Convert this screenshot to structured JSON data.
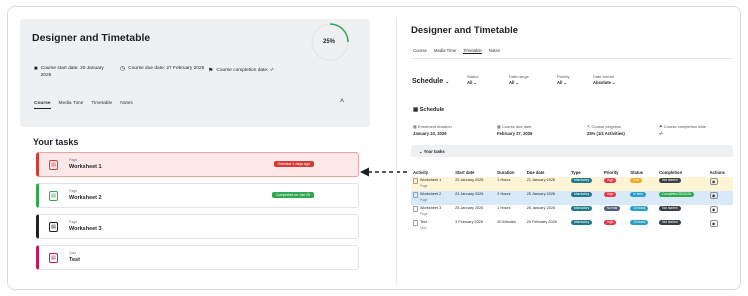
{
  "left": {
    "title": "Designer and Timetable",
    "progress_text": "25%",
    "progress_value": 0.25,
    "start": "Course start date: 20 January 2026",
    "due": "Course due date: 27 February 2026",
    "completion": "Course completion date: -/-",
    "tabs": [
      "Course",
      "Media Time",
      "Timetable",
      "Notes"
    ],
    "your_tasks": "Your tasks",
    "tasks": [
      {
        "type": "Page",
        "name": "Worksheet 1",
        "badge": "Overdue 1 days ago",
        "badge_color": "#d63b3b",
        "accent": "#d63b3b"
      },
      {
        "type": "Page",
        "name": "Worksheet 2",
        "badge": "Completed on Jan 25",
        "badge_color": "#2fa84f",
        "accent": "#2fa84f"
      },
      {
        "type": "Page",
        "name": "Worksheet 3",
        "badge": "",
        "badge_color": "",
        "accent": "#1d2125"
      },
      {
        "type": "Quiz",
        "name": "Test",
        "badge": "",
        "badge_color": "",
        "accent": "#c2185b"
      }
    ]
  },
  "right": {
    "title": "Designer and Timetable",
    "tabs": [
      "Course",
      "Media Time",
      "Timetable",
      "Notes"
    ],
    "schedule_select": "Schedule",
    "filters": [
      {
        "label": "Status",
        "value": "All"
      },
      {
        "label": "Date range",
        "value": "All"
      },
      {
        "label": "Priority",
        "value": "All"
      },
      {
        "label": "Date format",
        "value": "Absolute"
      }
    ],
    "section": "Schedule",
    "info": [
      {
        "label": "Enrolment duration",
        "value": "January 23, 2026"
      },
      {
        "label": "Course due date",
        "value": "February 27, 2026"
      },
      {
        "label": "Course progress",
        "value": "25% (1/4 Activities)"
      },
      {
        "label": "Course completion date",
        "value": "-/-"
      }
    ],
    "tasks_bar": "Your tasks",
    "columns": [
      "Activity",
      "Start date",
      "Duration",
      "Due date",
      "Type",
      "Priority",
      "Status",
      "Completion",
      "Actions"
    ],
    "rows": [
      {
        "name": "Worksheet 1",
        "sub": "Page",
        "start": "20 January 2026",
        "duration": "1 Hours",
        "due": "21 January 2026",
        "type": "Mandatory",
        "priority": "High",
        "status": "Due",
        "completion": "Not started"
      },
      {
        "name": "Worksheet 2",
        "sub": "Page",
        "start": "24 January 2026",
        "duration": "2 Hours",
        "due": "25 January 2026",
        "type": "Mandatory",
        "priority": "High",
        "status": "In time",
        "completion": "Completed 25/01/26"
      },
      {
        "name": "Worksheet 3",
        "sub": "Page",
        "start": "25 January 2026",
        "duration": "1 Hours",
        "due": "26 January 2026",
        "type": "Mandatory",
        "priority": "Normal",
        "status": "On track",
        "completion": "Not started"
      },
      {
        "name": "Test",
        "sub": "Quiz",
        "start": "3 February 2026",
        "duration": "30 Minutes",
        "due": "20 February 2026",
        "type": "Mandatory",
        "priority": "High",
        "status": "On track",
        "completion": "Not started"
      }
    ]
  },
  "colors": {
    "mandatory": "#1f7a8c",
    "high": "#e2364a",
    "normal": "#4a5f7a",
    "due": "#f2a92c",
    "in_time": "#2a9ec7",
    "on_track": "#2a9ec7",
    "completed": "#2fa84f",
    "not_started": "#3a3f45",
    "progress": "#2fa84f"
  }
}
